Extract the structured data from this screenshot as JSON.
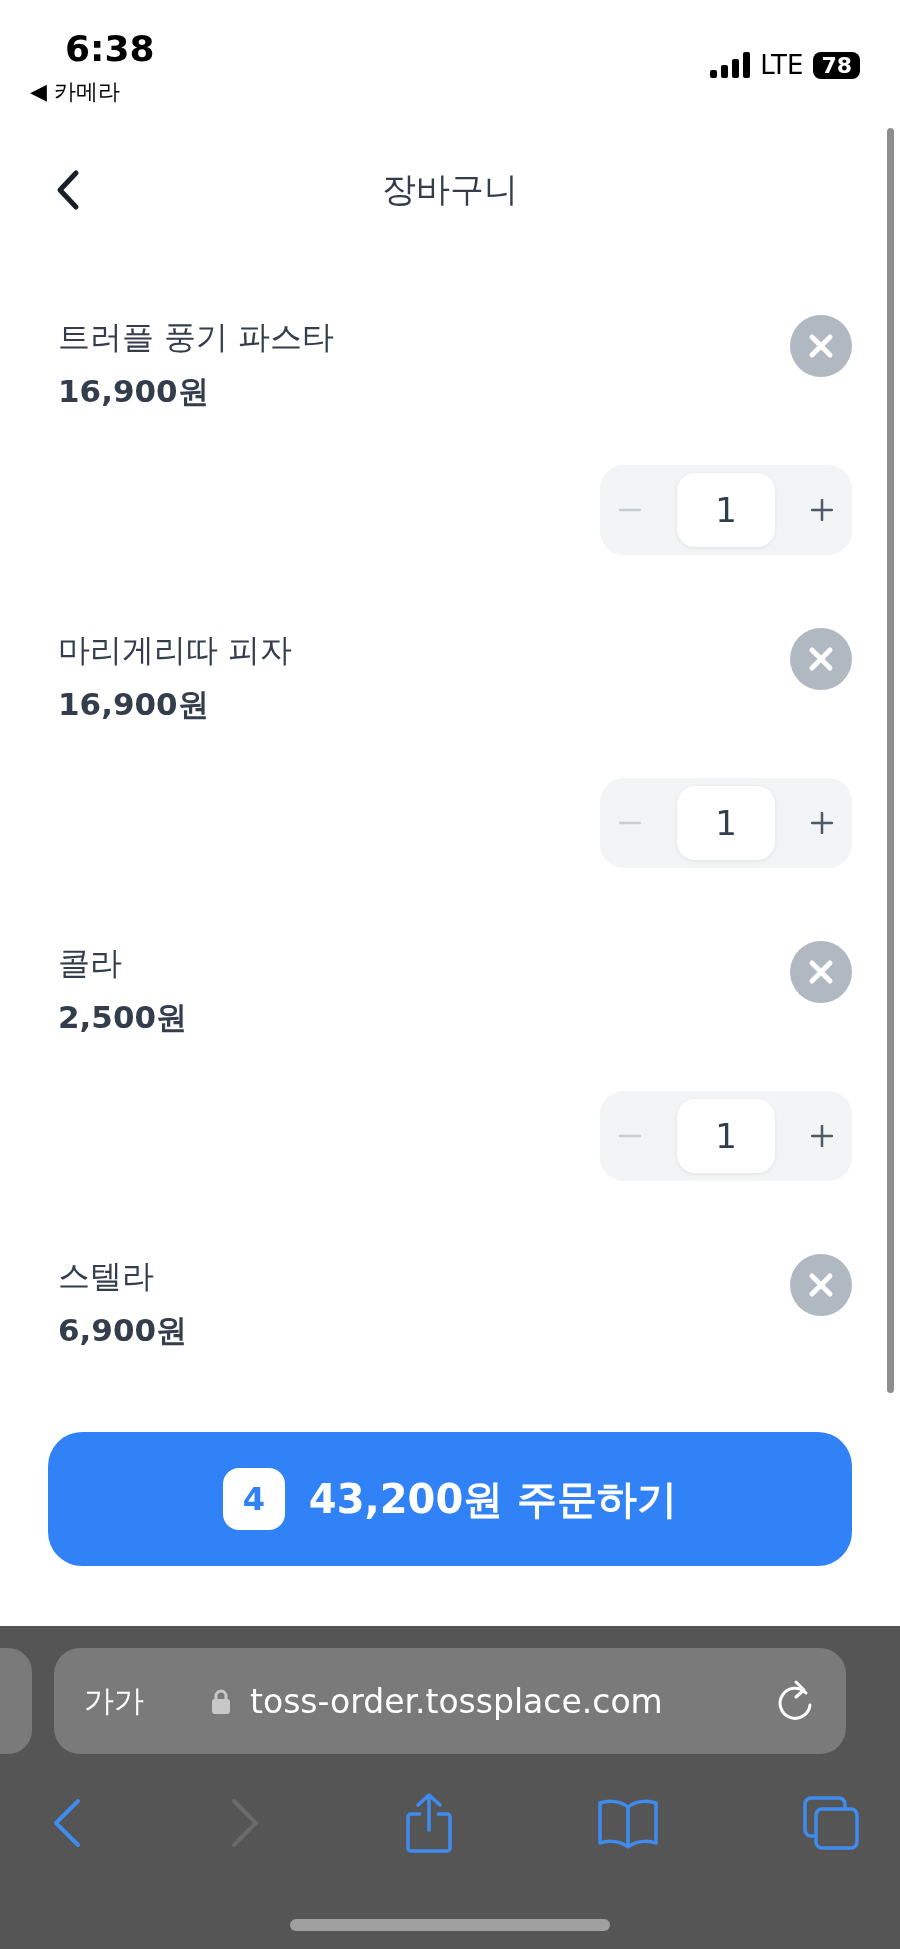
{
  "status_bar": {
    "time": "6:38",
    "back_app": "◀ 카메라",
    "network": "LTE",
    "battery": "78"
  },
  "header": {
    "title": "장바구니"
  },
  "items": [
    {
      "name": "트러플 풍기 파스타",
      "price": "16,900원",
      "quantity": "1",
      "minus_disabled": true
    },
    {
      "name": "마리게리따 피자",
      "price": "16,900원",
      "quantity": "1",
      "minus_disabled": true
    },
    {
      "name": "콜라",
      "price": "2,500원",
      "quantity": "1",
      "minus_disabled": true
    },
    {
      "name": "스텔라",
      "price": "6,900원"
    }
  ],
  "order_button": {
    "count": "4",
    "label": "43,200원 주문하기"
  },
  "browser": {
    "text_size": "가가",
    "url": "toss-order.tossplace.com",
    "forward_disabled": true
  }
}
